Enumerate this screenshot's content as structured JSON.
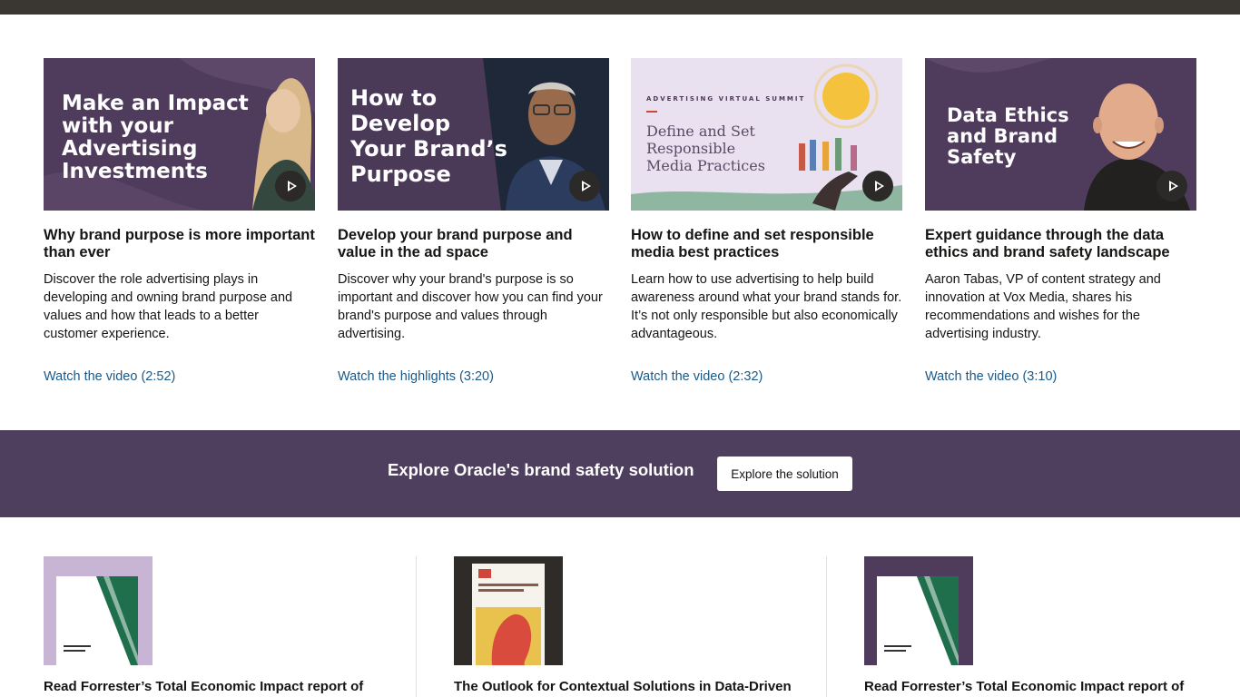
{
  "videos": [
    {
      "thumb_text": "Make an Impact with your Advertising Investments",
      "title": "Why brand purpose is more important than ever",
      "desc": "Discover the role advertising plays in developing and owning brand purpose and values and how that leads to a better customer experience.",
      "link": "Watch the video (2:52)"
    },
    {
      "thumb_text": "How to Develop Your Brand’s Purpose",
      "title": "Develop your brand purpose and value in the ad space",
      "desc": "Discover why your brand's purpose is so important and discover how you can find your brand's purpose and values through advertising.",
      "link": "Watch the highlights (3:20)"
    },
    {
      "thumb_kicker": "ADVERTISING VIRTUAL SUMMIT",
      "thumb_text": "Define and Set Responsible Media Practices",
      "title": "How to define and set responsible media best practices",
      "desc": "Learn how to use advertising to help build awareness around what your brand stands for. It’s not only responsible but also economically advantageous.",
      "link": "Watch the video (2:32)"
    },
    {
      "thumb_text": "Data Ethics and Brand Safety",
      "title": "Expert guidance through the data ethics and brand safety landscape",
      "desc": "Aaron Tabas, VP of content strategy and innovation at Vox Media, shares his recommendations and wishes for the advertising industry.",
      "link": "Watch the video (3:10)"
    }
  ],
  "banner": {
    "title": "Explore Oracle's brand safety solution",
    "button": "Explore the solution"
  },
  "reports": [
    {
      "title": "Read Forrester’s Total Economic Impact report of"
    },
    {
      "title": "The Outlook for Contextual Solutions in Data-Driven"
    },
    {
      "title": "Read Forrester’s Total Economic Impact report of"
    }
  ],
  "colors": {
    "topbar": "#3a3632",
    "banner": "#4f3f5e",
    "link": "#1a5a8a",
    "thumb_purple": "#4f3b5c"
  }
}
